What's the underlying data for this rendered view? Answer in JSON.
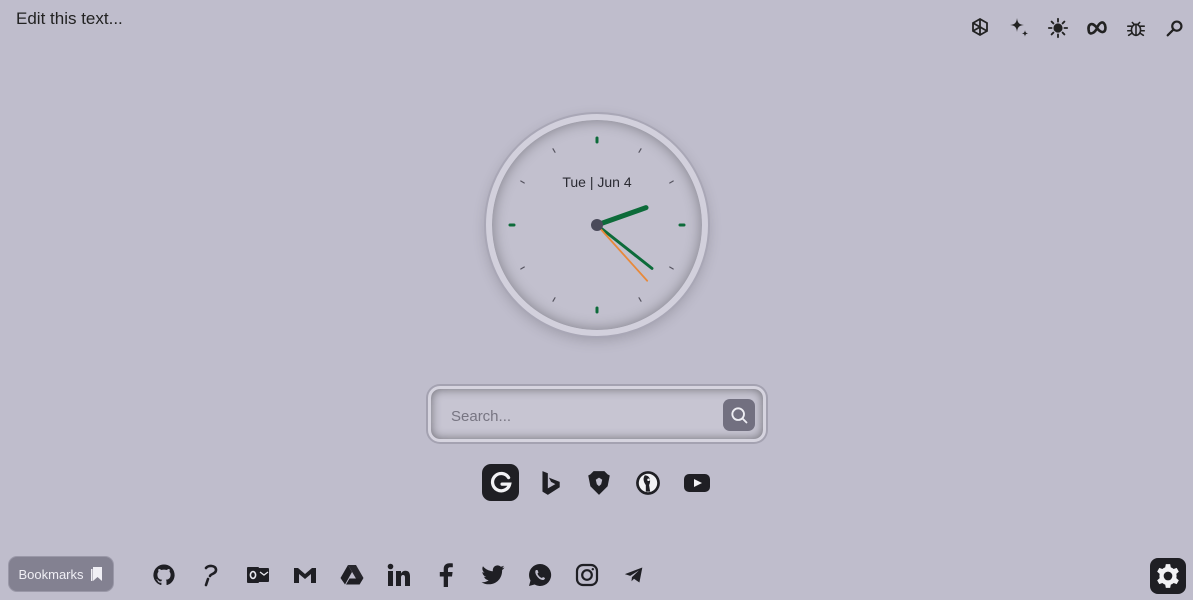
{
  "header": {
    "user_text": "Edit this text..."
  },
  "ai_tools": [
    {
      "icon": "chatgpt-icon"
    },
    {
      "icon": "gemini-sparkle-icon"
    },
    {
      "icon": "copilot-sun-icon"
    },
    {
      "icon": "meta-ai-icon"
    },
    {
      "icon": "bug-icon"
    },
    {
      "icon": "perplexity-search-icon"
    }
  ],
  "clock": {
    "date": "Tue | Jun 4",
    "time": {
      "hours": 2,
      "minutes": 21,
      "seconds": 23
    },
    "colors": {
      "hour_hand": "#0d6b3a",
      "minute_hand": "#0d6b3a",
      "second_hand": "#e8893a",
      "markers": "#0d6b3a"
    }
  },
  "search": {
    "placeholder": "Search...",
    "button_icon": "search-icon"
  },
  "search_engines": [
    {
      "icon": "google-icon",
      "selected": true
    },
    {
      "icon": "bing-icon",
      "selected": false
    },
    {
      "icon": "brave-icon",
      "selected": false
    },
    {
      "icon": "duckduckgo-icon",
      "selected": false
    },
    {
      "icon": "youtube-icon",
      "selected": false
    }
  ],
  "bookmarks": {
    "label": "Bookmarks",
    "icon": "bookmark-icon"
  },
  "shortcuts": [
    {
      "icon": "github-icon"
    },
    {
      "icon": "perplexity-icon"
    },
    {
      "icon": "outlook-icon"
    },
    {
      "icon": "gmail-icon"
    },
    {
      "icon": "google-drive-icon"
    },
    {
      "icon": "linkedin-icon"
    },
    {
      "icon": "facebook-icon"
    },
    {
      "icon": "twitter-icon"
    },
    {
      "icon": "whatsapp-icon"
    },
    {
      "icon": "instagram-icon"
    },
    {
      "icon": "telegram-icon"
    }
  ],
  "settings": {
    "icon": "gear-icon"
  },
  "colors": {
    "background": "#bfbdcc",
    "accent": "#0d6b3a",
    "dark_button": "#1f1f24"
  }
}
